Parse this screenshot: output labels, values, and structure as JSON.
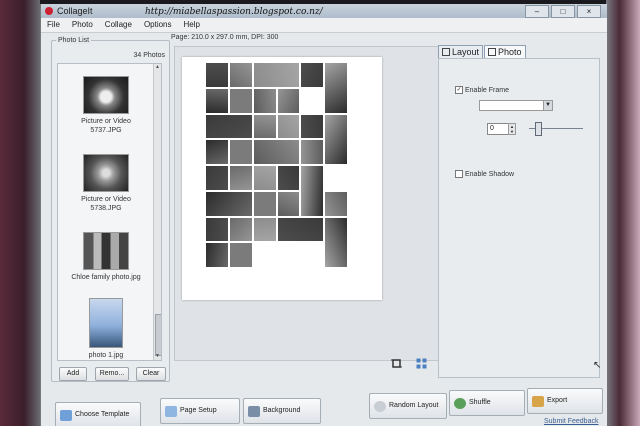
{
  "window": {
    "title": "CollageIt",
    "watermark": "http://miabellaspassion.blogspot.co.nz/"
  },
  "menu": [
    "File",
    "Photo",
    "Collage",
    "Options",
    "Help"
  ],
  "photo_list": {
    "title": "Photo List",
    "count": "34 Photos",
    "items": [
      {
        "caption": "Picture or Video 5737.JPG",
        "line1": "Picture or Video",
        "line2": "5737.JPG",
        "icon": "flower-thumbnail"
      },
      {
        "caption": "Picture or Video 5738.JPG",
        "line1": "Picture or Video",
        "line2": "5738.JPG",
        "icon": "rose-thumbnail"
      },
      {
        "caption": "Chloe family photo.jpg",
        "line1": "Chloe family photo.jpg",
        "line2": "",
        "icon": "family-thumbnail"
      },
      {
        "caption": "photo 1.jpg",
        "line1": "photo 1.jpg",
        "line2": "",
        "icon": "sky-thumbnail"
      }
    ],
    "buttons": {
      "add": "Add",
      "remove": "Remo...",
      "clear": "Clear"
    }
  },
  "canvas": {
    "page_info": "Page: 210.0 x 297.0 mm, DPI: 300"
  },
  "settings": {
    "tabs": [
      {
        "label": "Layout",
        "active": false
      },
      {
        "label": "Photo",
        "active": true
      }
    ],
    "enable_frame": {
      "label": "Enable Frame",
      "checked": true
    },
    "frame_value": "",
    "stepper_value": "0",
    "enable_shadow": {
      "label": "Enable Shadow",
      "checked": false
    }
  },
  "bottom_buttons": {
    "choose_template": "Choose Template",
    "page_setup": "Page Setup",
    "background": "Background",
    "random_layout": "Random Layout",
    "shuffle": "Shuffle",
    "export": "Export"
  },
  "feedback_link": "Submit Feedback",
  "colors": {
    "accent": "#3a5f92",
    "page": "#ffffff",
    "titlebar": "#aebccb"
  }
}
